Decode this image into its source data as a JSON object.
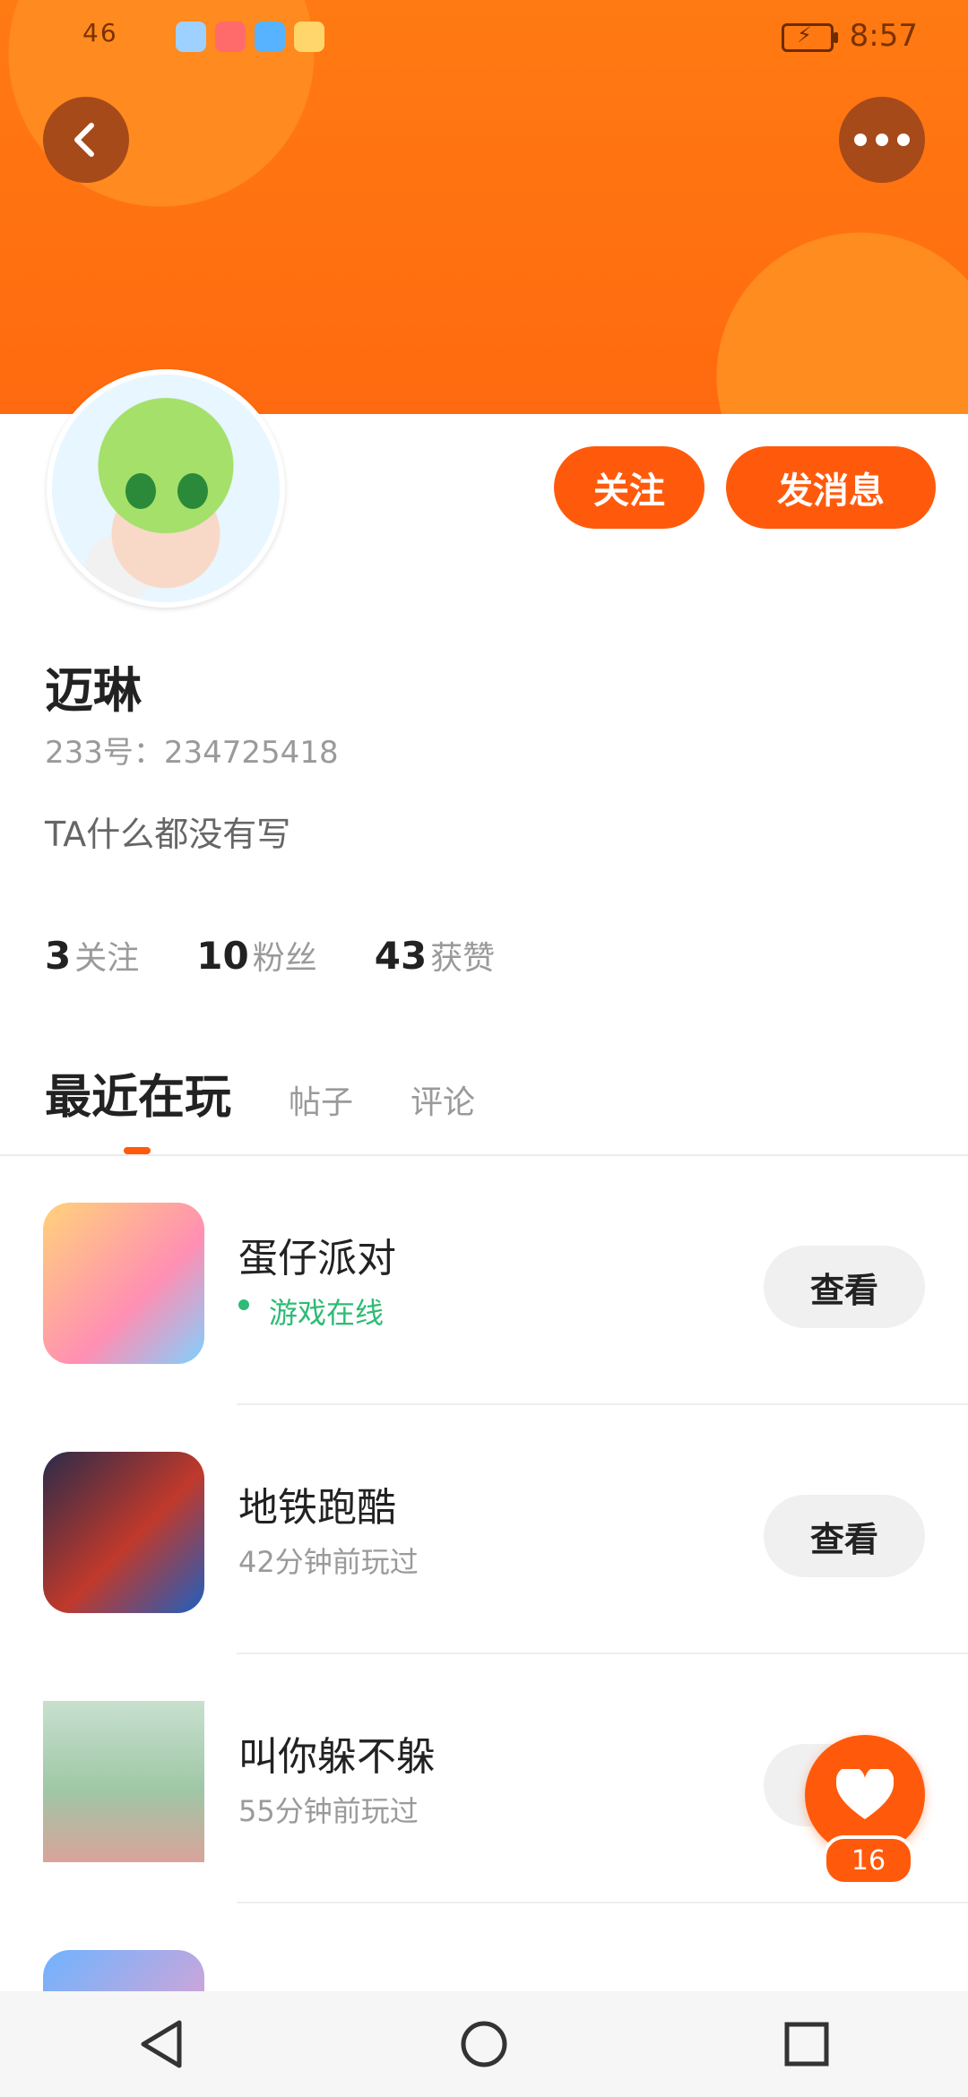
{
  "status_bar": {
    "network": "46",
    "time": "8:57"
  },
  "profile": {
    "name": "迈琳",
    "uid": "233号：234725418",
    "bio": "TA什么都没有写",
    "follow_label": "关注",
    "message_label": "发消息",
    "stats": [
      {
        "num": "3",
        "label": "关注"
      },
      {
        "num": "10",
        "label": "粉丝"
      },
      {
        "num": "43",
        "label": "获赞"
      }
    ]
  },
  "tabs": [
    {
      "label": "最近在玩",
      "active": true
    },
    {
      "label": "帖子",
      "active": false
    },
    {
      "label": "评论",
      "active": false
    }
  ],
  "games": [
    {
      "title": "蛋仔派对",
      "sub": "游戏在线",
      "online": true,
      "button": "查看",
      "icon_color": "#ffcf73"
    },
    {
      "title": "地铁跑酷",
      "sub": "42分钟前玩过",
      "online": false,
      "button": "查看",
      "icon_color": "#c0392b"
    },
    {
      "title": "叫你躲不躲",
      "sub": "55分钟前玩过",
      "online": false,
      "button": "查看",
      "icon_color": "#9fc7a6"
    }
  ],
  "like_fab": {
    "count": "16"
  },
  "colors": {
    "accent": "#ff5a0c",
    "header": "#ff7a12",
    "online": "#2dbb75"
  },
  "icons": [
    "back-icon",
    "more-icon",
    "heart-icon",
    "nav-back-icon",
    "nav-home-icon",
    "nav-recents-icon"
  ]
}
